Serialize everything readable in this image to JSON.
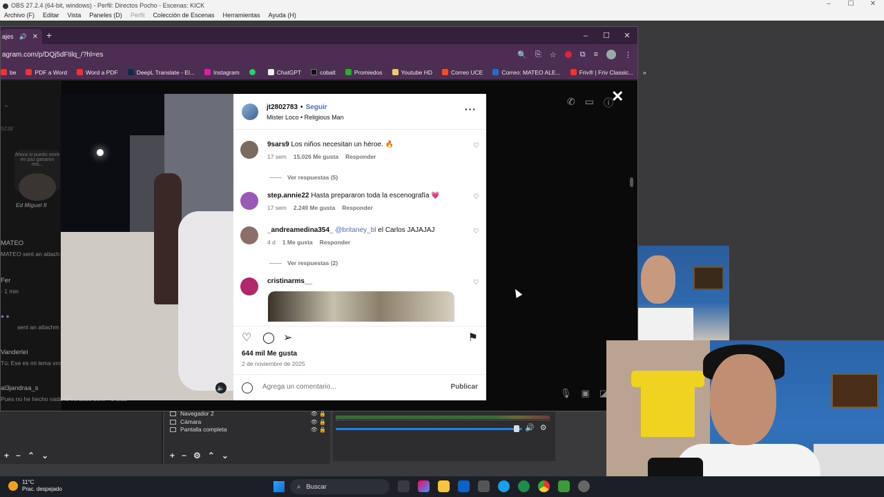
{
  "obs": {
    "title": "OBS 27.2.4 (64-bit, windows) - Perfil: Directos Pocho - Escenas: KICK",
    "menu": [
      "Archivo (F)",
      "Editar",
      "Vista",
      "Paneles (D)",
      "Perfil",
      "Colección de Escenas",
      "Herramientas",
      "Ayuda (H)"
    ],
    "sources": [
      "Navegador 2",
      "Cámara",
      "Pantalla completa"
    ]
  },
  "browser": {
    "tab_label": "ajes",
    "url": "agram.com/p/DQj5dFtilq_/?hl=es",
    "bookmarks": [
      {
        "label": "be",
        "color": "#e33"
      },
      {
        "label": "PDF a Word",
        "color": "#e33"
      },
      {
        "label": "Word a PDF",
        "color": "#e33"
      },
      {
        "label": "DeepL Translate - El...",
        "color": "#0f2b46"
      },
      {
        "label": "Instagram",
        "color": "#d6249f"
      },
      {
        "label": "",
        "color": "#25d366"
      },
      {
        "label": "ChatGPT",
        "color": "#eee"
      },
      {
        "label": "cobalt",
        "color": "#111"
      },
      {
        "label": "Promiedos",
        "color": "#3a3"
      },
      {
        "label": "Youtube HD",
        "color": "#e8c97a"
      },
      {
        "label": "Correo UCE",
        "color": "#f25022"
      },
      {
        "label": "Correo: MATEO ALE...",
        "color": "#1f6fd1"
      },
      {
        "label": "Friv® | Friv Classic...",
        "color": "#e33"
      }
    ]
  },
  "ig_sidebar": {
    "story_text": "Ahora si puedo morir en paz ganaron mis...",
    "story_caption": "Ed Miguel II",
    "search_placeholder": "scar",
    "chats": [
      {
        "name": "MATEO",
        "preview": "MATEO sent an attach"
      },
      {
        "name": "Fer",
        "preview": "· 1 min"
      },
      {
        "name": "",
        "preview": "sent an attachm"
      },
      {
        "name": "Vanderlei",
        "preview": "Tú: Ese es mi lema vro"
      },
      {
        "name": "al3jandraa_s",
        "preview": "Pues no he hecho nada la verdado sol... · 3 días"
      }
    ]
  },
  "post": {
    "username": "jt2802783",
    "follow": "Seguir",
    "subtitle": "Mister Loco • Religious Man",
    "comments": [
      {
        "user": "9sars9",
        "text": "Los niños necesitan un héroe. 🔥",
        "time": "17 sem",
        "likes": "15.026 Me gusta",
        "reply": "Responder",
        "replies": "Ver respuestas (5)",
        "color": "#7a6a60"
      },
      {
        "user": "step.annie22",
        "text": "Hasta prepararon toda la escenografía 💗",
        "time": "17 sem",
        "likes": "2.249 Me gusta",
        "reply": "Responder",
        "replies": "",
        "color": "#9b59b6"
      },
      {
        "user": "_andreamedina354_",
        "mention": "@britaney_bl",
        "text": "el Carlos JAJAJAJ",
        "time": "4 d",
        "likes": "1 Me gusta",
        "reply": "Responder",
        "replies": "Ver respuestas (2)",
        "color": "#8a6f6a"
      },
      {
        "user": "cristinarms__",
        "text": "",
        "time": "",
        "likes": "",
        "reply": "",
        "replies": "",
        "color": "#b0286a"
      }
    ],
    "like_count": "644 mil Me gusta",
    "date": "2 de noviembre de 2025",
    "comment_placeholder": "Agrega un comentario...",
    "publish": "Publicar"
  },
  "taskbar": {
    "temperature": "11°C",
    "weather": "Prac. despejado",
    "search": "Buscar"
  }
}
